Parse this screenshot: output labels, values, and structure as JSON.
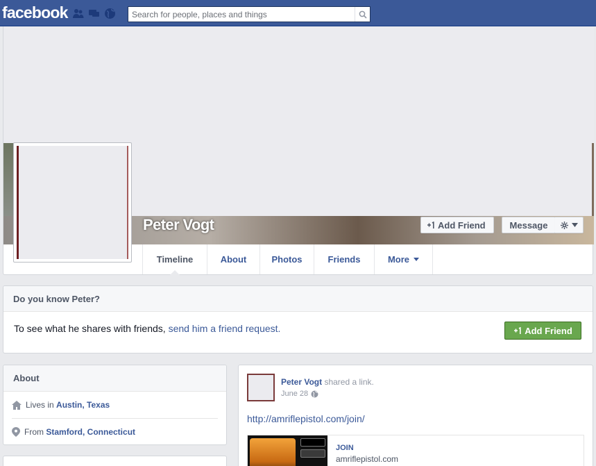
{
  "topbar": {
    "logo": "facebook",
    "search_placeholder": "Search for people, places and things",
    "jewels": [
      "friends-icon",
      "messages-icon",
      "notifications-globe-icon"
    ],
    "color": "#3b5998"
  },
  "profile": {
    "name": "Peter Vogt",
    "add_friend_label": "Add Friend",
    "message_label": "Message",
    "tabs": [
      "Timeline",
      "About",
      "Photos",
      "Friends",
      "More"
    ],
    "active_tab": "Timeline"
  },
  "know": {
    "title": "Do you know Peter?",
    "text": "To see what he shares with friends, ",
    "link": "send him a friend request.",
    "button": "Add Friend",
    "button_color": "#69a74e"
  },
  "about": {
    "title": "About",
    "lives_prefix": "Lives in ",
    "lives_link": "Austin, Texas",
    "from_prefix": "From ",
    "from_link": "Stamford, Connecticut"
  },
  "post": {
    "author": "Peter Vogt",
    "action": " shared a link.",
    "date": "June 28",
    "url": "http://amriflepistol.com/join/",
    "link_title": "JOIN",
    "link_domain": "amriflepistol.com"
  }
}
